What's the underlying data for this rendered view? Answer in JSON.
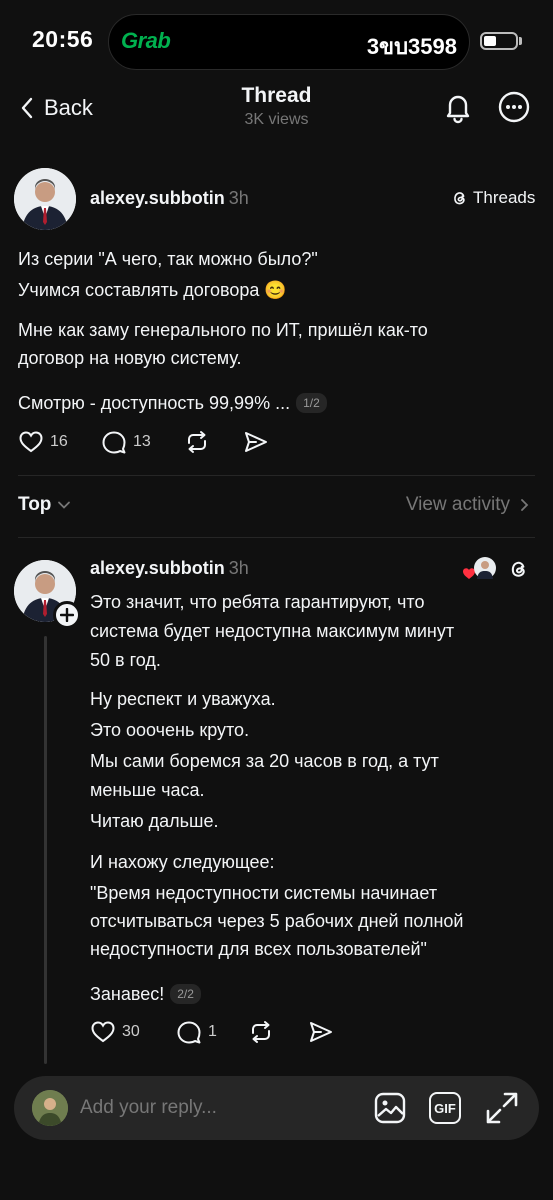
{
  "status": {
    "time": "20:56",
    "island_logo": "Grab",
    "island_plate": "3ขบ3598"
  },
  "nav": {
    "back_label": "Back",
    "title": "Thread",
    "subtitle": "3K views"
  },
  "post": {
    "username": "alexey.subbotin",
    "time": "3h",
    "source_label": "Threads",
    "paragraphs": [
      "Из серии \"А чего, так можно было?\"",
      "Учимся составлять договора 😊",
      "Мне как заму генерального по ИТ, пришёл как-то",
      "договор на новую систему.",
      "Смотрю - доступность 99,99% ..."
    ],
    "pager": "1/2",
    "likes": "16",
    "comments": "13"
  },
  "sort": {
    "label": "Top",
    "view_activity": "View activity"
  },
  "reply": {
    "username": "alexey.subbotin",
    "time": "3h",
    "lines": [
      "Это значит, что ребята гарантируют, что",
      "система будет недоступна максимум минут",
      "50 в год.",
      "Ну респект и уважуха.",
      "Это ооочень круто.",
      "Мы сами боремся за 20 часов в год, а тут",
      "меньше часа.",
      "Читаю дальше.",
      "И нахожу следующее:",
      "\"Время недоступности системы начинает",
      "отсчитываться через 5 рабочих дней полной",
      "недоступности для всех пользователей\"",
      "Занавес!"
    ],
    "pager": "2/2",
    "likes": "30",
    "comments": "1"
  },
  "composer": {
    "placeholder": "Add your reply...",
    "gif_label": "GIF"
  },
  "colors": {
    "background": "#101010",
    "text": "#f3f5f7",
    "muted": "#777777",
    "grab_green": "#00b14f",
    "like_red": "#ff3040"
  }
}
